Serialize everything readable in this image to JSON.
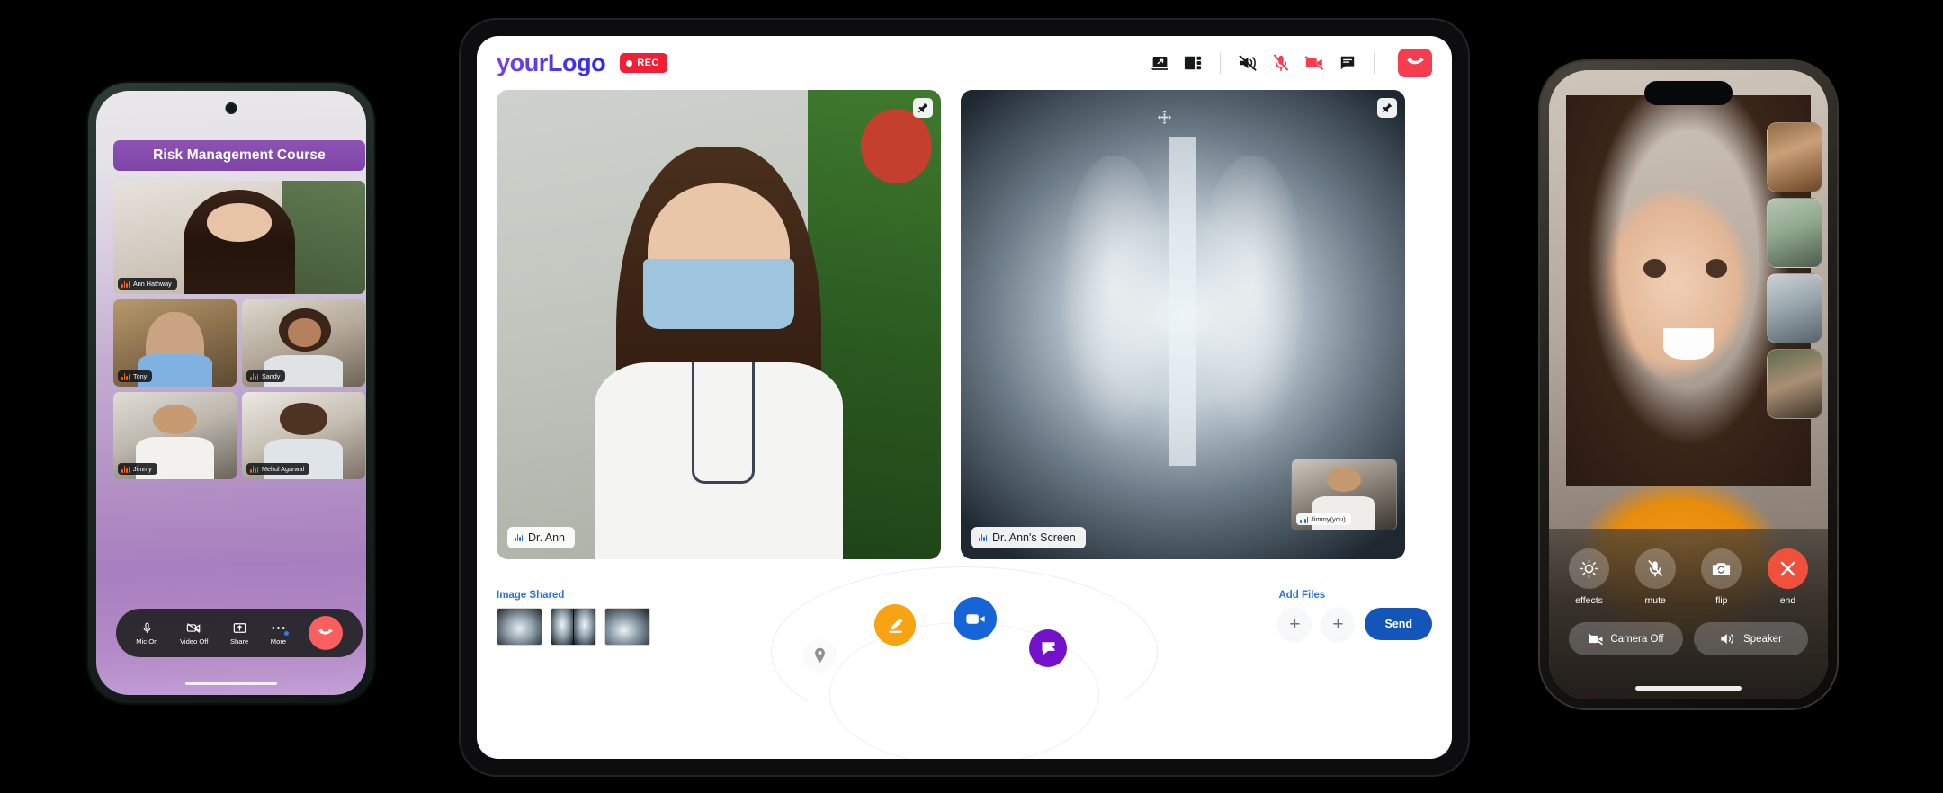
{
  "phone_left": {
    "course_title": "Risk Management Course",
    "participants": [
      {
        "name": "Ann Hathway",
        "position": "main"
      },
      {
        "name": "Tony",
        "position": "row1-left"
      },
      {
        "name": "Sandy",
        "position": "row1-right"
      },
      {
        "name": "Jimmy",
        "position": "row2-left"
      },
      {
        "name": "Mehul Agarwal",
        "position": "row2-right"
      }
    ],
    "controls": [
      {
        "label": "Mic On",
        "icon": "microphone-icon",
        "state": "on"
      },
      {
        "label": "Video Off",
        "icon": "video-off-icon",
        "state": "off"
      },
      {
        "label": "Share",
        "icon": "share-upload-icon",
        "state": "idle"
      },
      {
        "label": "More",
        "icon": "more-dots-icon",
        "state": "badge"
      }
    ],
    "end_call": {
      "icon": "end-call-icon",
      "color": "#fa5e5e"
    }
  },
  "tablet": {
    "logo": "yourLogo",
    "recording_badge": "REC",
    "toolbar": [
      {
        "name": "share-screen-icon",
        "label": "Share Screen"
      },
      {
        "name": "layout-view-icon",
        "label": "Change Layout"
      },
      {
        "name": "speaker-off-icon",
        "label": "Speaker Off"
      },
      {
        "name": "mic-off-icon",
        "label": "Mic Off"
      },
      {
        "name": "video-off-icon",
        "label": "Video Off"
      },
      {
        "name": "chat-icon",
        "label": "Chat"
      }
    ],
    "end_call_label": "End Call",
    "tiles": [
      {
        "label": "Dr. Ann",
        "type": "camera",
        "pinned": false
      },
      {
        "label": "Dr. Ann's Screen",
        "type": "screen-share",
        "pinned": false,
        "pip_label": "Jimmy(you)"
      }
    ],
    "shared": {
      "label": "Image Shared",
      "items": [
        {
          "alt": "shoulder-xray"
        },
        {
          "alt": "chest-xray"
        },
        {
          "alt": "wrist-xray"
        }
      ]
    },
    "add_files": {
      "label": "Add Files",
      "buttons": [
        "+",
        "+"
      ],
      "send_label": "Send"
    },
    "fabs": [
      {
        "name": "location-pin-icon",
        "color": "#fbfbfc"
      },
      {
        "name": "edit-pencil-icon",
        "color": "#f7a313"
      },
      {
        "name": "video-camera-icon",
        "color": "#1565d8"
      },
      {
        "name": "chat-bubble-icon",
        "color": "#7211c9"
      }
    ]
  },
  "phone_right": {
    "round_controls": [
      {
        "label": "effects",
        "icon": "effects-icon"
      },
      {
        "label": "mute",
        "icon": "mic-off-icon"
      },
      {
        "label": "flip",
        "icon": "camera-flip-icon"
      },
      {
        "label": "end",
        "icon": "close-x-icon"
      }
    ],
    "pill_controls": [
      {
        "label": "Camera Off",
        "icon": "video-off-icon"
      },
      {
        "label": "Speaker",
        "icon": "speaker-icon"
      }
    ],
    "thumbnails": [
      {
        "alt": "participant-1"
      },
      {
        "alt": "participant-2"
      },
      {
        "alt": "participant-3"
      },
      {
        "alt": "participant-4"
      }
    ]
  },
  "colors": {
    "accent_purple": "#7e45a8",
    "accent_blue": "#1355b8",
    "danger_red": "#f43d4f",
    "rec_red": "#f01f35",
    "orange": "#f7a313"
  }
}
